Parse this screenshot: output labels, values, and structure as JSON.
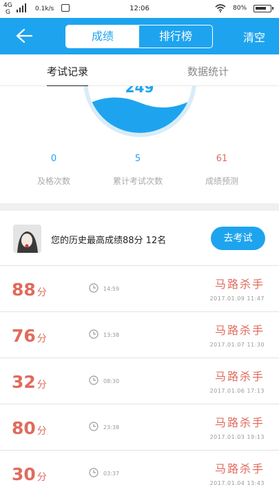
{
  "status_bar": {
    "network": "4G",
    "network2": "G",
    "speed": "0.1k/s",
    "time": "12:06",
    "battery": "80%"
  },
  "header": {
    "tabs": [
      {
        "label": "成绩",
        "active": true
      },
      {
        "label": "排行榜",
        "active": false
      }
    ],
    "clear_label": "清空",
    "accent_color": "#1ea4ef"
  },
  "subtabs": [
    {
      "label": "考试记录",
      "active": true
    },
    {
      "label": "数据统计",
      "active": false
    }
  ],
  "gauge": {
    "score_partial": "249"
  },
  "stats": [
    {
      "value": "0",
      "label": "及格次数"
    },
    {
      "value": "5",
      "label": "累计考试次数"
    },
    {
      "value": "61",
      "label": "成绩预测"
    }
  ],
  "best": {
    "text": "您的历史最高成绩88分   12名",
    "button": "去考试"
  },
  "records": [
    {
      "score": "88",
      "unit": "分",
      "duration": "14:59",
      "name": "马路杀手",
      "date": "2017.01.09   11:47"
    },
    {
      "score": "76",
      "unit": "分",
      "duration": "13:38",
      "name": "马路杀手",
      "date": "2017.01.07   11:30"
    },
    {
      "score": "32",
      "unit": "分",
      "duration": "08:30",
      "name": "马路杀手",
      "date": "2017.01.06   17:13"
    },
    {
      "score": "80",
      "unit": "分",
      "duration": "23:38",
      "name": "马路杀手",
      "date": "2017.01.03   19:13"
    },
    {
      "score": "30",
      "unit": "分",
      "duration": "03:37",
      "name": "马路杀手",
      "date": "2017.01.04   13:43"
    }
  ],
  "colors": {
    "score_red": "#e06b5e",
    "muted": "#999999"
  }
}
